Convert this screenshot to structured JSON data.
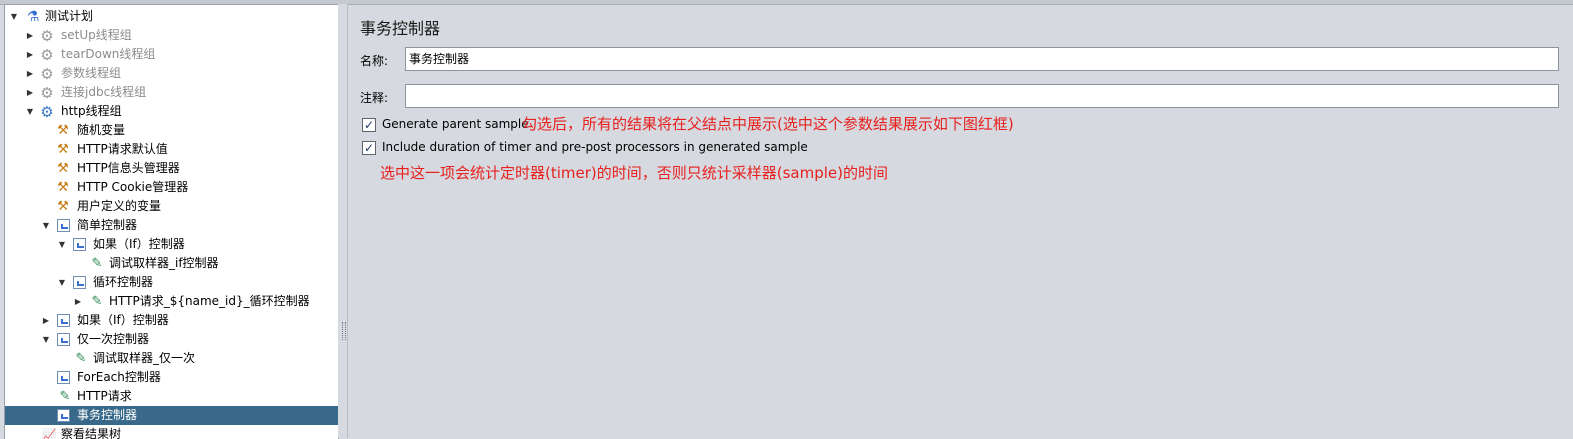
{
  "tree": {
    "items": [
      {
        "label": "测试计划",
        "expanded": true,
        "icon": "flask-icon"
      },
      {
        "label": "setUp线程组",
        "disabled": true,
        "icon": "gear-icon"
      },
      {
        "label": "tearDown线程组",
        "disabled": true,
        "icon": "gear-icon"
      },
      {
        "label": "参数线程组",
        "disabled": true,
        "icon": "gear-icon"
      },
      {
        "label": "连接jdbc线程组",
        "disabled": true,
        "icon": "gear-icon"
      },
      {
        "label": "http线程组",
        "expanded": true,
        "icon": "gear-icon"
      },
      {
        "label": "随机变量",
        "icon": "tools-icon"
      },
      {
        "label": "HTTP请求默认值",
        "icon": "tools-icon"
      },
      {
        "label": "HTTP信息头管理器",
        "icon": "tools-icon"
      },
      {
        "label": "HTTP Cookie管理器",
        "icon": "tools-icon"
      },
      {
        "label": "用户定义的变量",
        "icon": "tools-icon"
      },
      {
        "label": "简单控制器",
        "expanded": true,
        "icon": "controller-icon"
      },
      {
        "label": "如果（If）控制器",
        "expanded": true,
        "icon": "controller-icon"
      },
      {
        "label": "调试取样器_if控制器",
        "icon": "pipette-icon"
      },
      {
        "label": "循环控制器",
        "expanded": true,
        "icon": "controller-icon"
      },
      {
        "label": "HTTP请求_${name_id}_循环控制器",
        "collapsed": true,
        "icon": "pipette-icon"
      },
      {
        "label": "如果（If）控制器",
        "collapsed": true,
        "icon": "controller-icon"
      },
      {
        "label": "仅一次控制器",
        "expanded": true,
        "icon": "controller-icon"
      },
      {
        "label": "调试取样器_仅一次",
        "icon": "pipette-icon"
      },
      {
        "label": "ForEach控制器",
        "icon": "controller-icon"
      },
      {
        "label": "HTTP请求",
        "icon": "pipette-icon"
      },
      {
        "label": "事务控制器",
        "selected": true,
        "icon": "controller-icon"
      },
      {
        "label": "察看结果树",
        "icon": "chart-icon"
      }
    ]
  },
  "panel": {
    "title": "事务控制器",
    "name_label": "名称:",
    "name_value": "事务控制器",
    "comment_label": "注释:",
    "comment_value": "",
    "cb1_label": "Generate parent sample",
    "cb1_checked": true,
    "cb2_label": "Include duration of timer and pre-post processors in generated sample",
    "cb2_checked": true
  },
  "annotations": {
    "a1": "勾选后，所有的结果将在父结点中展示(选中这个参数结果展示如下图红框)",
    "a2": "选中这一项会统计定时器(timer)的时间，否则只统计采样器(sample)的时间"
  },
  "colors": {
    "selection": "#39698a",
    "annotation": "#e8201e",
    "background": "#d6d9df"
  }
}
